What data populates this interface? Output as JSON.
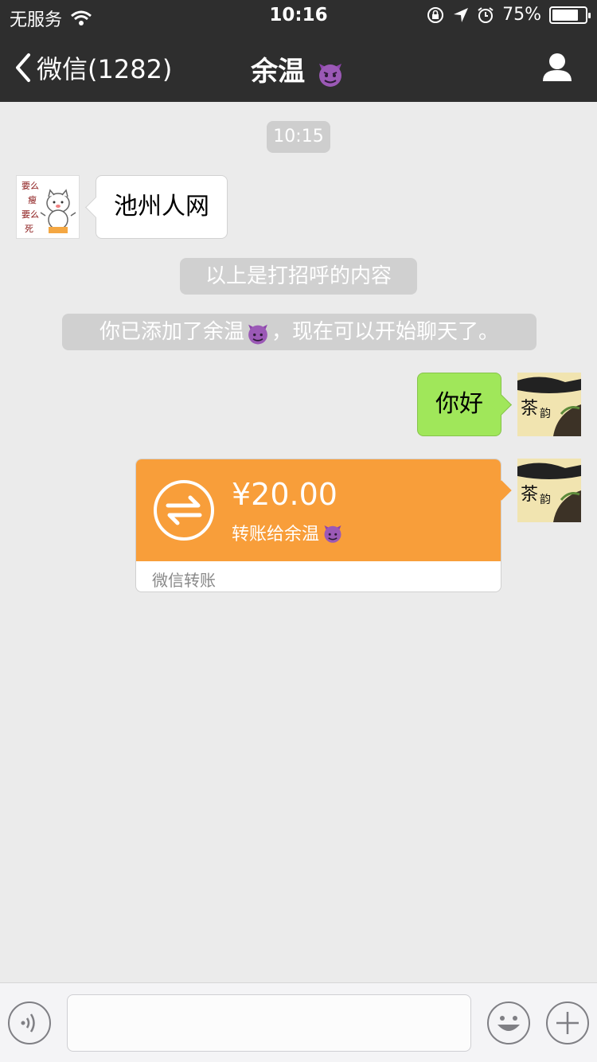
{
  "status_bar": {
    "carrier": "无服务",
    "time": "10:16",
    "battery_percent": "75%",
    "battery_level": 0.75
  },
  "nav": {
    "back_label": "微信(1282)",
    "title": "余温",
    "title_emoji": "smiling-devil-emoji",
    "profile_icon": "person-icon"
  },
  "chat": {
    "timestamp": "10:15",
    "incoming_message": "池州人网",
    "system_messages": [
      "以上是打招呼的内容",
      "你已添加了余温",
      "，现在可以开始聊天了。"
    ],
    "outgoing_message": "你好",
    "transfer": {
      "amount": "¥20.00",
      "description": "转账给余温",
      "footer": "微信转账"
    }
  },
  "toolbar": {
    "input_value": "",
    "voice_icon": "voice-icon",
    "emoji_icon": "emoji-icon",
    "plus_icon": "plus-icon"
  },
  "colors": {
    "nav_bg": "#2e2e2e",
    "chat_bg": "#ebebeb",
    "outgoing_bubble": "#a0e75a",
    "transfer_orange": "#f89e3a"
  }
}
